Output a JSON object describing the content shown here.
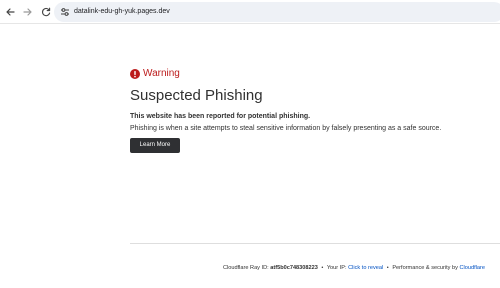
{
  "browser": {
    "url": "datalink-edu-gh-yuk.pages.dev"
  },
  "page": {
    "warning_label": "Warning",
    "title": "Suspected Phishing",
    "subtitle": "This website has been reported for potential phishing.",
    "description": "Phishing is when a site attempts to steal sensitive information by falsely presenting as a safe source.",
    "learn_more_label": "Learn More"
  },
  "footer": {
    "ray_label": "Cloudflare Ray ID:",
    "ray_id": "atf5b0c748308223",
    "separator": "•",
    "ip_label": "Your IP:",
    "ip_link": "Click to reveal",
    "security_label": "Performance & security by",
    "cloudflare_link": "Cloudflare"
  },
  "colors": {
    "warning": "#bc1c1c",
    "button_bg": "#2f3033",
    "link": "#0051c3"
  },
  "icons": {
    "back": "arrow-left-icon",
    "forward": "arrow-right-icon",
    "reload": "reload-icon",
    "site_info": "tune-icon",
    "warning": "exclamation-circle-icon"
  }
}
